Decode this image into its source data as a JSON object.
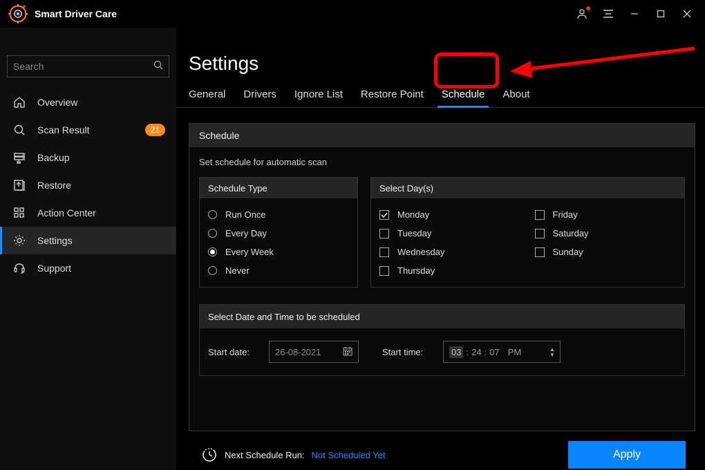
{
  "app": {
    "title": "Smart Driver Care"
  },
  "titlebar": {
    "user_icon": "user-icon",
    "menu_icon": "menu-icon",
    "min_icon": "minimize-icon",
    "max_icon": "maximize-icon",
    "close_icon": "close-icon"
  },
  "search": {
    "placeholder": "Search"
  },
  "sidebar": {
    "items": [
      {
        "icon": "home-icon",
        "label": "Overview"
      },
      {
        "icon": "search-icon",
        "label": "Scan Result",
        "badge": "21"
      },
      {
        "icon": "backup-icon",
        "label": "Backup"
      },
      {
        "icon": "restore-icon",
        "label": "Restore"
      },
      {
        "icon": "grid-icon",
        "label": "Action Center"
      },
      {
        "icon": "gear-icon",
        "label": "Settings",
        "active": true
      },
      {
        "icon": "headset-icon",
        "label": "Support"
      }
    ]
  },
  "page": {
    "title": "Settings"
  },
  "tabs": [
    {
      "label": "General"
    },
    {
      "label": "Drivers"
    },
    {
      "label": "Ignore List"
    },
    {
      "label": "Restore Point"
    },
    {
      "label": "Schedule",
      "active": true
    },
    {
      "label": "About"
    }
  ],
  "schedule": {
    "panel_title": "Schedule",
    "desc": "Set schedule for automatic scan",
    "schedule_type": {
      "title": "Schedule Type",
      "options": [
        {
          "label": "Run Once",
          "selected": false
        },
        {
          "label": "Every Day",
          "selected": false
        },
        {
          "label": "Every Week",
          "selected": true
        },
        {
          "label": "Never",
          "selected": false
        }
      ]
    },
    "select_days": {
      "title": "Select Day(s)",
      "col1": [
        {
          "label": "Monday",
          "checked": true
        },
        {
          "label": "Tuesday",
          "checked": false
        },
        {
          "label": "Wednesday",
          "checked": false
        },
        {
          "label": "Thursday",
          "checked": false
        }
      ],
      "col2": [
        {
          "label": "Friday",
          "checked": false
        },
        {
          "label": "Saturday",
          "checked": false
        },
        {
          "label": "Sunday",
          "checked": false
        }
      ]
    },
    "datetime": {
      "title": "Select Date and Time to be scheduled",
      "start_date_label": "Start date:",
      "start_date_value": "26-08-2021",
      "start_time_label": "Start time:",
      "time_hh": "03",
      "time_mm": "24",
      "time_ss": "07",
      "time_ampm": "PM"
    }
  },
  "footer": {
    "next_run_label": "Next Schedule Run:",
    "next_run_value": "Not Scheduled Yet",
    "apply_label": "Apply"
  }
}
